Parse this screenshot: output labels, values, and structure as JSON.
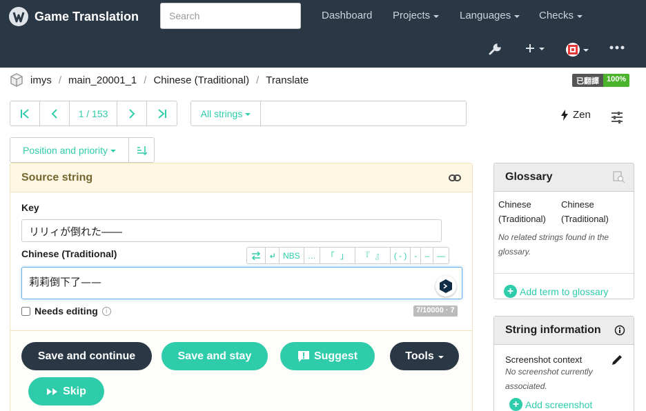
{
  "navbar": {
    "brand": "Game Translation",
    "search_placeholder": "Search",
    "links": [
      "Dashboard",
      "Projects",
      "Languages",
      "Checks"
    ],
    "icons": [
      "wrench-icon",
      "plus-icon",
      "avatar",
      "more-icon"
    ]
  },
  "breadcrumb": {
    "project": "imys",
    "component": "main_20001_1",
    "language": "Chinese (Traditional)",
    "page": "Translate"
  },
  "status_badge": {
    "label": "已翻譯",
    "percent": "100%"
  },
  "pager": {
    "position": "1 / 153"
  },
  "filter": {
    "label": "All strings",
    "query_value": ""
  },
  "zen_label": "Zen",
  "sort": {
    "label": "Position and priority"
  },
  "source_panel": {
    "title": "Source string",
    "key_label": "Key",
    "key_value": "リリィが倒れた――",
    "target_label": "Chinese (Traditional)",
    "translation": "莉莉倒下了——",
    "toolbar": {
      "nbs": "NBS",
      "ellipsis": "…",
      "quote_open": "「",
      "quote_close": "」",
      "dquote_open": "『",
      "dquote_close": "』",
      "paren": "( - )",
      "macron": "‐",
      "endash": "–",
      "emdash": "—"
    },
    "needs_editing": "Needs editing",
    "counter": "7/10000 · 7"
  },
  "actions": {
    "save_continue": "Save and continue",
    "save_stay": "Save and stay",
    "suggest": "Suggest",
    "tools": "Tools",
    "skip": "Skip"
  },
  "glossary": {
    "title": "Glossary",
    "col1": "Chinese (Traditional)",
    "col2": "Chinese (Traditional)",
    "empty": "No related strings found in the glossary.",
    "add": "Add term to glossary"
  },
  "string_info": {
    "title": "String information",
    "screenshot_label": "Screenshot context",
    "screenshot_empty": "No screenshot currently associated.",
    "add_screenshot": "Add screenshot"
  },
  "colors": {
    "navbar": "#2a3744",
    "accent": "#2eccaa",
    "source_header": "#fdf7e3",
    "badge_green": "#4bb32b"
  }
}
